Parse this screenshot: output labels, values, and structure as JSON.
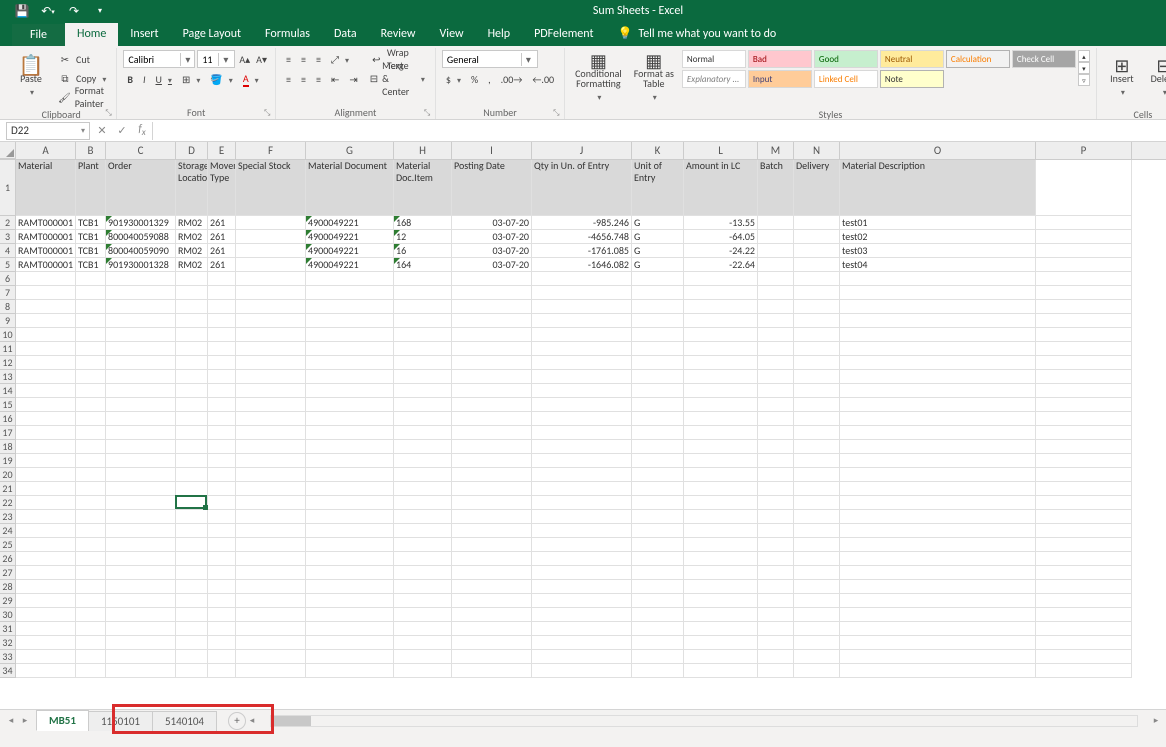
{
  "app": {
    "title": "Sum Sheets  -  Excel"
  },
  "qat": {
    "save": "save",
    "undo": "undo",
    "redo": "redo"
  },
  "menubar": {
    "file": "File",
    "home": "Home",
    "insert": "Insert",
    "page_layout": "Page Layout",
    "formulas": "Formulas",
    "data": "Data",
    "review": "Review",
    "view": "View",
    "help": "Help",
    "pdfelement": "PDFelement",
    "tellme": "Tell me what you want to do"
  },
  "ribbon": {
    "clipboard": {
      "paste": "Paste",
      "cut": "Cut",
      "copy": "Copy",
      "fmt_painter": "Format Painter",
      "title": "Clipboard"
    },
    "font": {
      "name": "Calibri",
      "size": "11",
      "title": "Font"
    },
    "alignment": {
      "wrap": "Wrap Text",
      "merge": "Merge & Center",
      "title": "Alignment"
    },
    "number": {
      "fmt": "General",
      "title": "Number"
    },
    "styles": {
      "cond": "Conditional\nFormatting",
      "table": "Format as\nTable",
      "items": [
        "Normal",
        "Bad",
        "Good",
        "Neutral",
        "Calculation",
        "Check Cell",
        "Explanatory ...",
        "Input",
        "Linked Cell",
        "Note"
      ],
      "title": "Styles"
    },
    "cells": {
      "insert": "Insert",
      "delete": "Delete",
      "title": "Cells"
    }
  },
  "namebox": "D22",
  "columns": [
    "A",
    "B",
    "C",
    "D",
    "E",
    "F",
    "G",
    "H",
    "I",
    "J",
    "K",
    "L",
    "M",
    "N",
    "O",
    "P"
  ],
  "headers": {
    "A": "Material",
    "B": "Plant",
    "C": "Order",
    "D": "Storage Location",
    "E": "Movement Type",
    "F": "Special Stock",
    "G": "Material Document",
    "H": "Material Doc.Item",
    "I": "Posting Date",
    "J": "Qty in Un. of Entry",
    "K": "Unit of Entry",
    "L": "Amount in LC",
    "M": "Batch",
    "N": "Delivery",
    "O": "Material Description"
  },
  "chart_data": {
    "type": "table",
    "columns": [
      "Material",
      "Plant",
      "Order",
      "Storage Location",
      "Movement Type",
      "Special Stock",
      "Material Document",
      "Material Doc.Item",
      "Posting Date",
      "Qty in Un. of Entry",
      "Unit of Entry",
      "Amount in LC",
      "Batch",
      "Delivery",
      "Material Description"
    ],
    "rows": [
      {
        "A": "RAMT000001",
        "B": "TCB1",
        "C": "901930001329",
        "D": "RM02",
        "E": "261",
        "F": "",
        "G": "4900049221",
        "H": "168",
        "I": "03-07-20",
        "J": "-985.246",
        "K": "G",
        "L": "-13.55",
        "M": "",
        "N": "",
        "O": "test01"
      },
      {
        "A": "RAMT000001",
        "B": "TCB1",
        "C": "800040059088",
        "D": "RM02",
        "E": "261",
        "F": "",
        "G": "4900049221",
        "H": "12",
        "I": "03-07-20",
        "J": "-4656.748",
        "K": "G",
        "L": "-64.05",
        "M": "",
        "N": "",
        "O": "test02"
      },
      {
        "A": "RAMT000001",
        "B": "TCB1",
        "C": "800040059090",
        "D": "RM02",
        "E": "261",
        "F": "",
        "G": "4900049221",
        "H": "16",
        "I": "03-07-20",
        "J": "-1761.085",
        "K": "G",
        "L": "-24.22",
        "M": "",
        "N": "",
        "O": "test03"
      },
      {
        "A": "RAMT000001",
        "B": "TCB1",
        "C": "901930001328",
        "D": "RM02",
        "E": "261",
        "F": "",
        "G": "4900049221",
        "H": "164",
        "I": "03-07-20",
        "J": "-1646.082",
        "K": "G",
        "L": "-22.64",
        "M": "",
        "N": "",
        "O": "test04"
      }
    ]
  },
  "sheets": {
    "active": "MB51",
    "list": [
      "MB51",
      "1150101",
      "5140104"
    ]
  },
  "selected_cell": "D22",
  "total_rows": 34
}
